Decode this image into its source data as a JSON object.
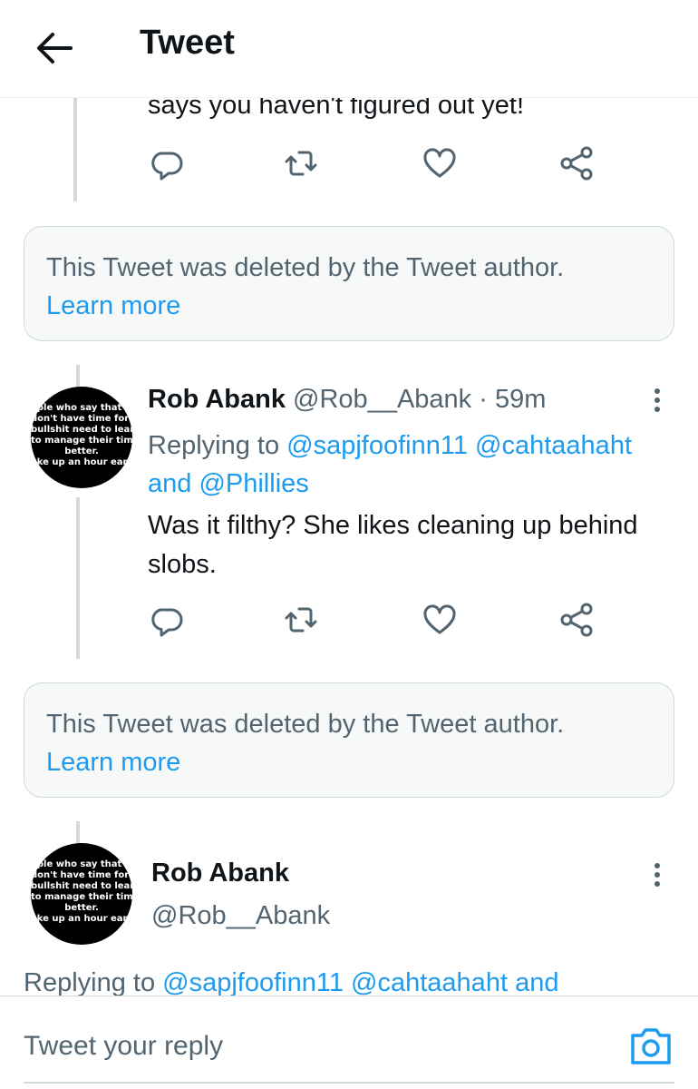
{
  "header": {
    "title": "Tweet",
    "back_icon": "arrow-left-icon"
  },
  "prev_tweet": {
    "text_tail": "says you haven't figured out yet!"
  },
  "deleted_notice": {
    "message": "This Tweet was deleted by the Tweet author.",
    "link": "Learn more"
  },
  "avatar": {
    "lines": [
      "ople who say that th",
      "don't have time for my",
      "bullshit need to learn how",
      "to manage their time",
      "better.",
      "ake up an hour earli"
    ]
  },
  "reply_tweet": {
    "name": "Rob Abank",
    "handle": "@Rob__Abank",
    "separator": "·",
    "time": "59m",
    "replying_prefix": "Replying to",
    "mention_1": "@sapjfoofinn11",
    "mention_2": "@cahtaahaht",
    "and_word": "and",
    "mention_3": "@Phillies",
    "body": "Was it filthy? She likes cleaning up behind slobs."
  },
  "focused_tweet": {
    "name": "Rob Abank",
    "handle": "@Rob__Abank",
    "replying_prefix": "Replying to",
    "mention_1": "@sapjfoofinn11",
    "mention_2": "@cahtaahaht",
    "and_word": "and"
  },
  "composer": {
    "placeholder": "Tweet your reply",
    "camera_icon": "camera-icon"
  },
  "colors": {
    "accent": "#1d9bf0",
    "secondary_text": "#536471",
    "border": "#cfd9de",
    "notice_bg": "#f7f9f9"
  },
  "action_icons": [
    "reply-icon",
    "retweet-icon",
    "like-icon",
    "share-icon"
  ]
}
